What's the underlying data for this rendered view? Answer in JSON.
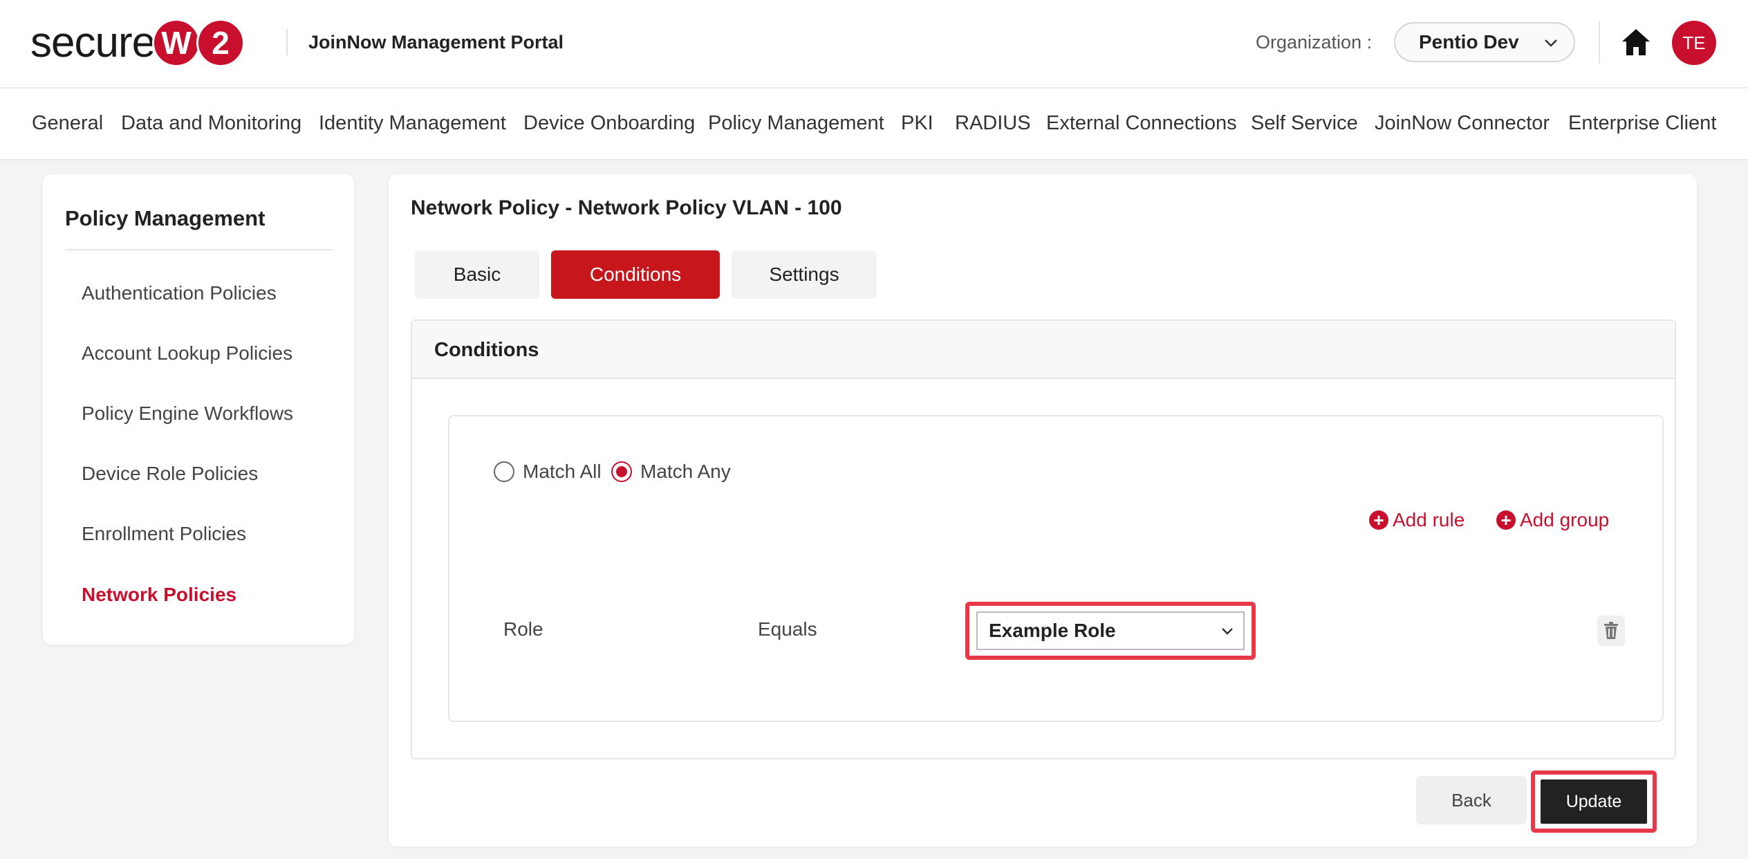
{
  "header": {
    "logo_text": "secure",
    "logo_badge_1": "W",
    "logo_badge_2": "2",
    "portal_title": "JoinNow Management Portal",
    "org_label": "Organization :",
    "org_value": "Pentio Dev",
    "avatar_initials": "TE",
    "icons": [
      "chevron-down-icon",
      "home-icon"
    ]
  },
  "nav": {
    "items": [
      "General",
      "Data and Monitoring",
      "Identity Management",
      "Device Onboarding",
      "Policy Management",
      "PKI",
      "RADIUS",
      "External Connections",
      "Self Service",
      "JoinNow Connector",
      "Enterprise Client"
    ]
  },
  "sidebar": {
    "title": "Policy Management",
    "items": [
      "Authentication Policies",
      "Account Lookup Policies",
      "Policy Engine Workflows",
      "Device Role Policies",
      "Enrollment Policies",
      "Network Policies"
    ],
    "active": "Network Policies"
  },
  "main": {
    "title": "Network Policy - Network Policy VLAN - 100",
    "tabs": [
      "Basic",
      "Conditions",
      "Settings"
    ],
    "active_tab": "Conditions",
    "conditions": {
      "heading": "Conditions",
      "match_all_label": "Match All",
      "match_any_label": "Match Any",
      "selected_match": "Match Any",
      "add_rule_label": "Add rule",
      "add_group_label": "Add group",
      "rule": {
        "field": "Role",
        "operator": "Equals",
        "value": "Example Role"
      }
    },
    "back_label": "Back",
    "update_label": "Update"
  },
  "colors": {
    "brand_red": "#c8102e",
    "highlight": "#e8394a",
    "dark_button": "#222222"
  }
}
